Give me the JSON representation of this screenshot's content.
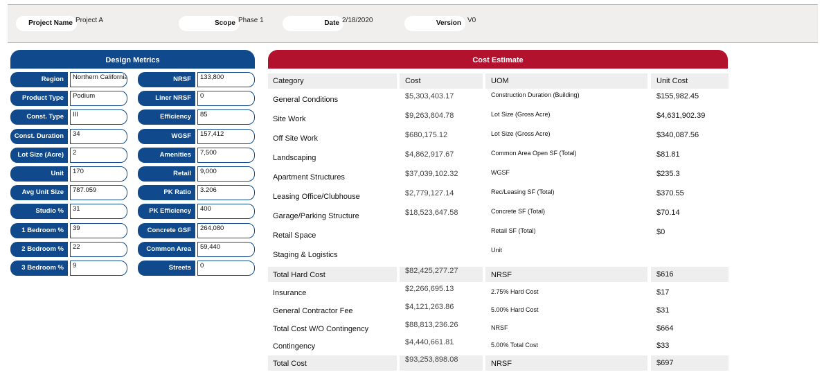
{
  "header": {
    "project_name_label": "Project Name",
    "project_name_value": "Project A",
    "scope_label": "Scope",
    "scope_value": "Phase 1",
    "date_label": "Date",
    "date_value": "2/18/2020",
    "version_label": "Version",
    "version_value": "V0"
  },
  "design_metrics": {
    "title": "Design Metrics",
    "left": [
      {
        "label": "Region",
        "value": "Northern California"
      },
      {
        "label": "Product Type",
        "value": "Podium"
      },
      {
        "label": "Const. Type",
        "value": "III"
      },
      {
        "label": "Const. Duration",
        "value": "34"
      },
      {
        "label": "Lot Size (Acre)",
        "value": "2"
      },
      {
        "label": "Unit",
        "value": "170"
      },
      {
        "label": "Avg Unit Size",
        "value": "787.059"
      },
      {
        "label": "Studio %",
        "value": "31"
      },
      {
        "label": "1 Bedroom %",
        "value": "39"
      },
      {
        "label": "2 Bedroom %",
        "value": "22"
      },
      {
        "label": "3 Bedroom %",
        "value": "9"
      }
    ],
    "right": [
      {
        "label": "NRSF",
        "value": "133,800"
      },
      {
        "label": "Liner NRSF",
        "value": "0"
      },
      {
        "label": "Efficiency",
        "value": "85"
      },
      {
        "label": "WGSF",
        "value": "157,412"
      },
      {
        "label": "Amenities",
        "value": "7,500"
      },
      {
        "label": "Retail",
        "value": "9,000"
      },
      {
        "label": "PK Ratio",
        "value": "3.206"
      },
      {
        "label": "PK Efficiency",
        "value": "400"
      },
      {
        "label": "Concrete GSF",
        "value": "264,080"
      },
      {
        "label": "Common Area",
        "value": "59,440"
      },
      {
        "label": "Streets",
        "value": "0"
      }
    ]
  },
  "cost_estimate": {
    "title": "Cost Estimate",
    "columns": [
      "Category",
      "Cost",
      "UOM",
      "Unit Cost"
    ],
    "rows": [
      {
        "category": "General Conditions",
        "cost": "$5,303,403.17",
        "uom": "Construction Duration (Building)",
        "unit_cost": "$155,982.45"
      },
      {
        "category": "Site Work",
        "cost": "$9,263,804.78",
        "uom": "Lot Size (Gross Acre)",
        "unit_cost": "$4,631,902.39"
      },
      {
        "category": "Off Site Work",
        "cost": "$680,175.12",
        "uom": "Lot Size (Gross Acre)",
        "unit_cost": "$340,087.56"
      },
      {
        "category": "Landscaping",
        "cost": "$4,862,917.67",
        "uom": "Common Area Open SF (Total)",
        "unit_cost": "$81.81"
      },
      {
        "category": "Apartment Structures",
        "cost": "$37,039,102.32",
        "uom": "WGSF",
        "unit_cost": "$235.3"
      },
      {
        "category": "Leasing Office/Clubhouse",
        "cost": "$2,779,127.14",
        "uom": "Rec/Leasing SF (Total)",
        "unit_cost": "$370.55"
      },
      {
        "category": "Garage/Parking Structure",
        "cost": "$18,523,647.58",
        "uom": "Concrete SF (Total)",
        "unit_cost": "$70.14"
      },
      {
        "category": "Retail Space",
        "cost": "",
        "uom": "Retail SF (Total)",
        "unit_cost": "$0"
      },
      {
        "category": "Staging & Logistics",
        "cost": "",
        "uom": "Unit",
        "unit_cost": ""
      }
    ],
    "summary": [
      {
        "category": "Total Hard Cost",
        "cost": "$82,425,277.27",
        "uom": "NRSF",
        "unit_cost": "$616",
        "shaded": true
      },
      {
        "category": "Insurance",
        "cost": "$2,266,695.13",
        "uom": "2.75% Hard Cost",
        "unit_cost": "$17",
        "shaded": false
      },
      {
        "category": "General Contractor Fee",
        "cost": "$4,121,263.86",
        "uom": "5.00% Hard Cost",
        "unit_cost": "$31",
        "shaded": false
      },
      {
        "category": "Total Cost W/O Contingency",
        "cost": "$88,813,236.26",
        "uom": "NRSF",
        "unit_cost": "$664",
        "shaded": false
      },
      {
        "category": "Contingency",
        "cost": "$4,440,661.81",
        "uom": "5.00% Total Cost",
        "unit_cost": "$33",
        "shaded": false
      },
      {
        "category": "Total Cost",
        "cost": "$93,253,898.08",
        "uom": "NRSF",
        "unit_cost": "$697",
        "shaded": true
      }
    ]
  }
}
